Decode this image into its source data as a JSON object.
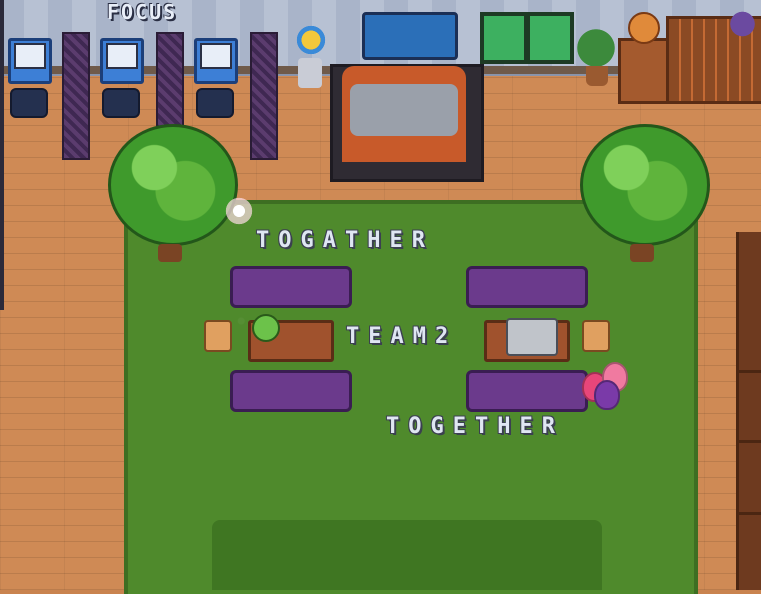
{
  "scene": {
    "area_labels": {
      "focus": "FOCUS",
      "together_top": "TOGATHER",
      "team": "TEAM2",
      "together_bottom": "TOGETHER"
    },
    "colors": {
      "floor": "#cf8a55",
      "grass": "#4f8a2c",
      "sofa": "#6b3a8c",
      "desk": "#3d7fd6",
      "label_text": "#dfe6f2"
    },
    "objects": {
      "desks": [
        "desk",
        "desk",
        "desk"
      ],
      "trees": [
        "tree",
        "tree"
      ],
      "sofas": [
        "sofa",
        "sofa",
        "sofa",
        "sofa"
      ],
      "balloons": [
        "#e8467a",
        "#7a3aa8",
        "#f07aa0"
      ],
      "icons": [
        "monitor-icon",
        "chair-icon",
        "tree-icon",
        "sofa-icon",
        "balloon-icon",
        "plant-icon",
        "globe-icon",
        "bookcase-icon",
        "player-avatar"
      ]
    }
  }
}
